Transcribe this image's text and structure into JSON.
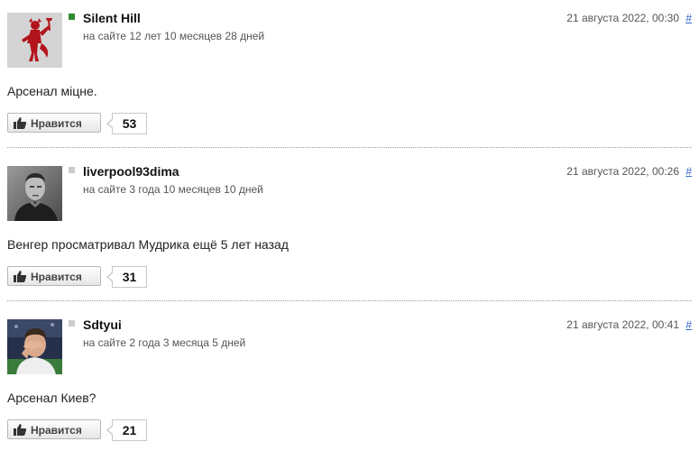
{
  "like_label": "Нравится",
  "colors": {
    "online": "#2e8b2e",
    "offline": "#cccccc",
    "link": "#3366cc"
  },
  "comments": [
    {
      "username": "Silent Hill",
      "membership": "на сайте 12 лет 10 месяцев 28 дней",
      "date": "21 августа 2022, 00:30",
      "permalink": "#",
      "text": "Арсенал міцне.",
      "likes": "53",
      "status": "online",
      "avatar": "red-devil-crest-avatar"
    },
    {
      "username": "liverpool93dima",
      "membership": "на сайте 3 года 10 месяцев 10 дней",
      "date": "21 августа 2022, 00:26",
      "permalink": "#",
      "text": "Венгер просматривал Мудрика ещё 5 лет назад",
      "likes": "31",
      "status": "offline",
      "avatar": "vintage-portrait-avatar"
    },
    {
      "username": "Sdtyui",
      "membership": "на сайте 2 года 3 месяца 5 дней",
      "date": "21 августа 2022, 00:41",
      "permalink": "#",
      "text": "Арсенал Киев?",
      "likes": "21",
      "status": "offline",
      "avatar": "player-facepalm-avatar"
    }
  ]
}
